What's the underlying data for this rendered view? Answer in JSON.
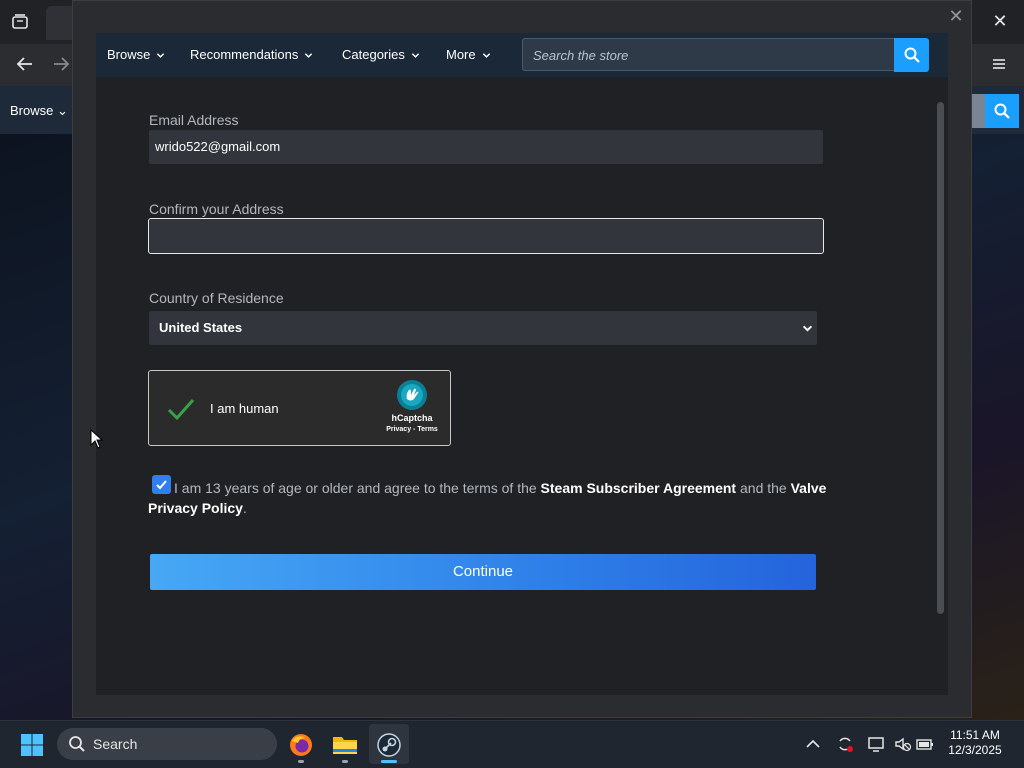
{
  "background": {
    "nav_browse": "Browse"
  },
  "store_nav": {
    "items": [
      "Browse",
      "Recommendations",
      "Categories",
      "More"
    ],
    "search_placeholder": "Search the store"
  },
  "form": {
    "email_label": "Email Address",
    "email_value": "wrido522@gmail.com",
    "confirm_label": "Confirm your Address",
    "confirm_value": "",
    "country_label": "Country of Residence",
    "country_value": "United States",
    "captcha": {
      "text": "I am human",
      "brand": "hCaptcha",
      "links": "Privacy - Terms",
      "checked": true
    },
    "agreement": {
      "checked": true,
      "prefix": "I am 13 years of age or older and agree to the terms of the",
      "ssa": "Steam Subscriber Agreement",
      "middle": "and the",
      "privacy": "Valve Privacy Policy",
      "suffix": "."
    },
    "continue_label": "Continue"
  },
  "taskbar": {
    "search_label": "Search",
    "time": "11:51 AM",
    "date": "12/3/2025"
  },
  "colors": {
    "accent": "#1a9fff",
    "continue_start": "#47a8f5",
    "continue_end": "#2563dc",
    "checkbox": "#2f7ff0",
    "captcha_check": "#3aa14b"
  }
}
